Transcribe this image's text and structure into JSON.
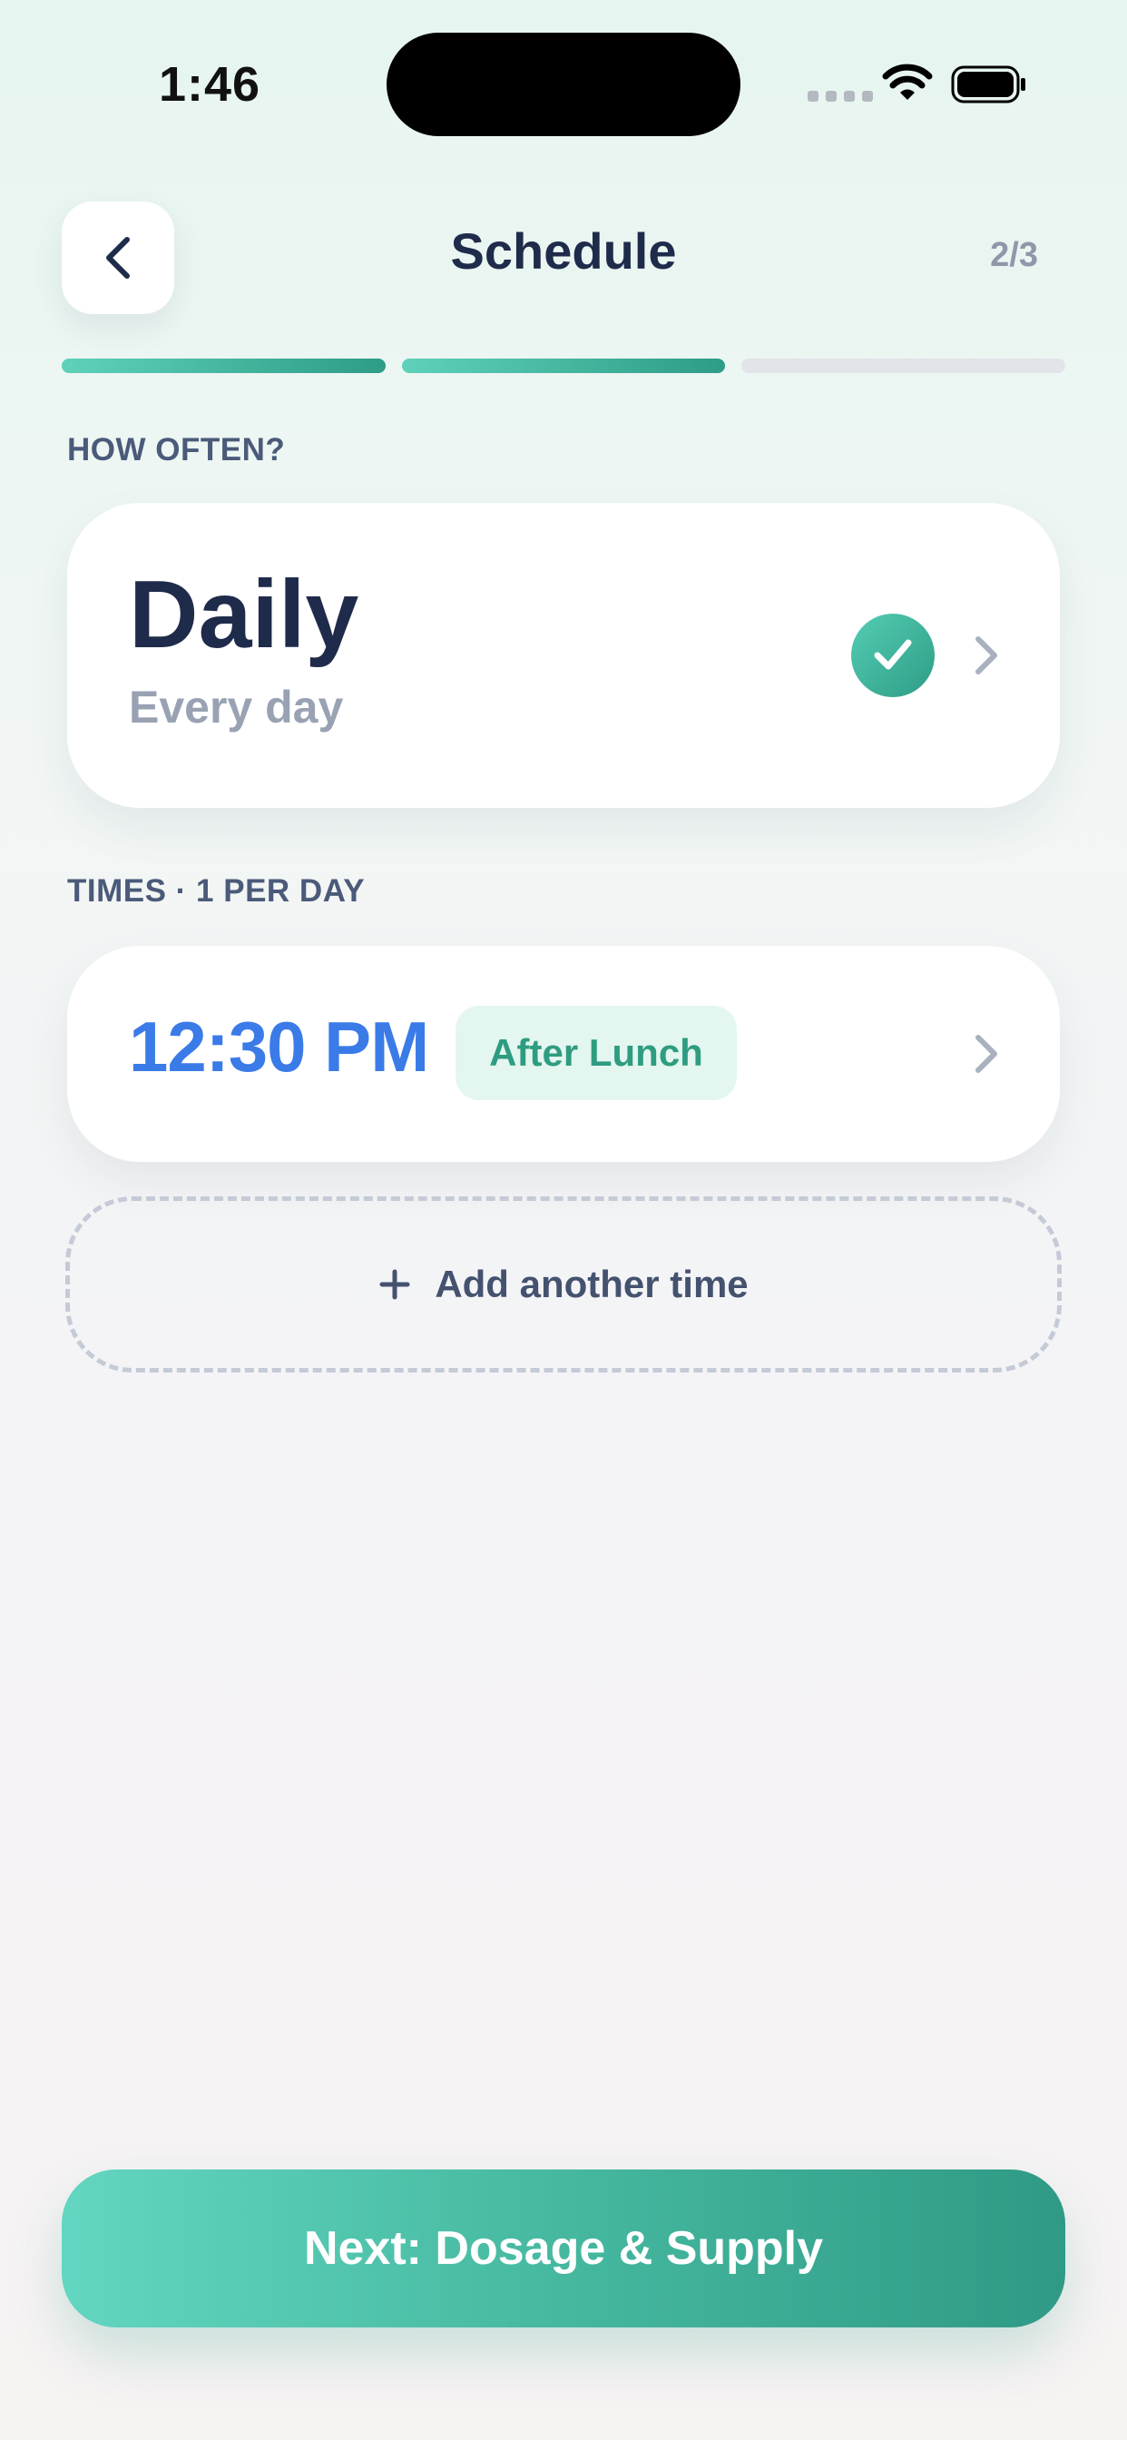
{
  "status_bar": {
    "time": "1:46"
  },
  "header": {
    "title": "Schedule",
    "step": "2/3",
    "progress": {
      "completed_steps": 2,
      "total_steps": 3
    }
  },
  "frequency": {
    "section_label": "HOW OFTEN?",
    "title": "Daily",
    "subtitle": "Every day",
    "selected": true
  },
  "times": {
    "section_label": "TIMES · 1 PER DAY",
    "items": [
      {
        "time": "12:30 PM",
        "tag": "After Lunch"
      }
    ],
    "add_label": "Add another time"
  },
  "next_button": {
    "label": "Next: Dosage & Supply"
  },
  "colors": {
    "accent_teal": "#2e9c86",
    "accent_teal_light": "#5fd1ba",
    "time_blue": "#3a7be8",
    "title_navy": "#1f2b4a",
    "muted_gray": "#98a2b3"
  },
  "icons": [
    "chevron-left-icon",
    "check-icon",
    "chevron-right-icon",
    "plus-icon",
    "wifi-icon",
    "battery-icon"
  ]
}
